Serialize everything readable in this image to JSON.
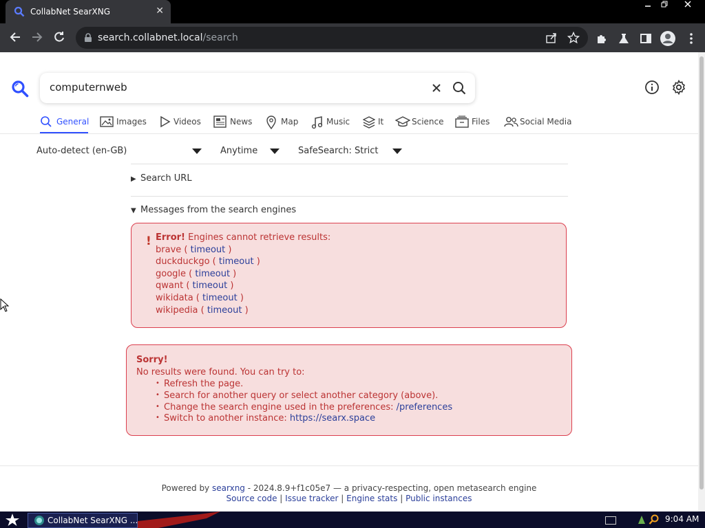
{
  "browser": {
    "tab_title": "CollabNet SearXNG",
    "tab_close": "✕",
    "url_host": "search.collabnet.local",
    "url_path": "/search"
  },
  "search": {
    "query": "computernweb"
  },
  "categories": [
    {
      "label": "General",
      "icon": "search-icon",
      "active": true
    },
    {
      "label": "Images",
      "icon": "image-icon"
    },
    {
      "label": "Videos",
      "icon": "play-icon"
    },
    {
      "label": "News",
      "icon": "newspaper-icon"
    },
    {
      "label": "Map",
      "icon": "map-pin-icon"
    },
    {
      "label": "Music",
      "icon": "music-note-icon"
    },
    {
      "label": "It",
      "icon": "layers-icon"
    },
    {
      "label": "Science",
      "icon": "graduation-cap-icon"
    },
    {
      "label": "Files",
      "icon": "files-icon"
    },
    {
      "label": "Social Media",
      "icon": "people-icon"
    }
  ],
  "filters": {
    "language": "Auto-detect (en-GB)",
    "time": "Anytime",
    "safesearch": "SafeSearch: Strict"
  },
  "sections": {
    "search_url": "Search URL",
    "messages": "Messages from the search engines",
    "collapsed_marker": "▶",
    "expanded_marker": "▼"
  },
  "errors": {
    "bang": "!",
    "title": "Error!",
    "message": "Engines cannot retrieve results:",
    "engines": [
      {
        "name": "brave",
        "reason": "timeout"
      },
      {
        "name": "duckduckgo",
        "reason": "timeout"
      },
      {
        "name": "google",
        "reason": "timeout"
      },
      {
        "name": "qwant",
        "reason": "timeout"
      },
      {
        "name": "wikidata",
        "reason": "timeout"
      },
      {
        "name": "wikipedia",
        "reason": "timeout"
      }
    ]
  },
  "sorry": {
    "title": "Sorry!",
    "subtitle": "No results were found. You can try to:",
    "items": {
      "refresh": "Refresh the page.",
      "another_query": "Search for another query or select another category (above).",
      "change_engine": "Change the search engine used in the preferences:",
      "change_engine_link": "/preferences",
      "switch_instance": "Switch to another instance:",
      "switch_instance_link": "https://searx.space"
    }
  },
  "footer": {
    "powered_by": "Powered by",
    "searxng_link": "searxng",
    "version_text": "- 2024.8.9+f1c05e7 — a privacy-respecting, open metasearch engine",
    "source_code": "Source code",
    "issue_tracker": "Issue tracker",
    "engine_stats": "Engine stats",
    "public_instances": "Public instances",
    "separator": "|"
  },
  "taskbar": {
    "task_label": "CollabNet SearXNG ...",
    "clock": "9:04 AM"
  },
  "colors": {
    "accent": "#3050ff",
    "error_bg": "#f7dede",
    "error_border": "#db3e4d",
    "error_text": "#bb3333",
    "link": "#2b3f9a"
  }
}
